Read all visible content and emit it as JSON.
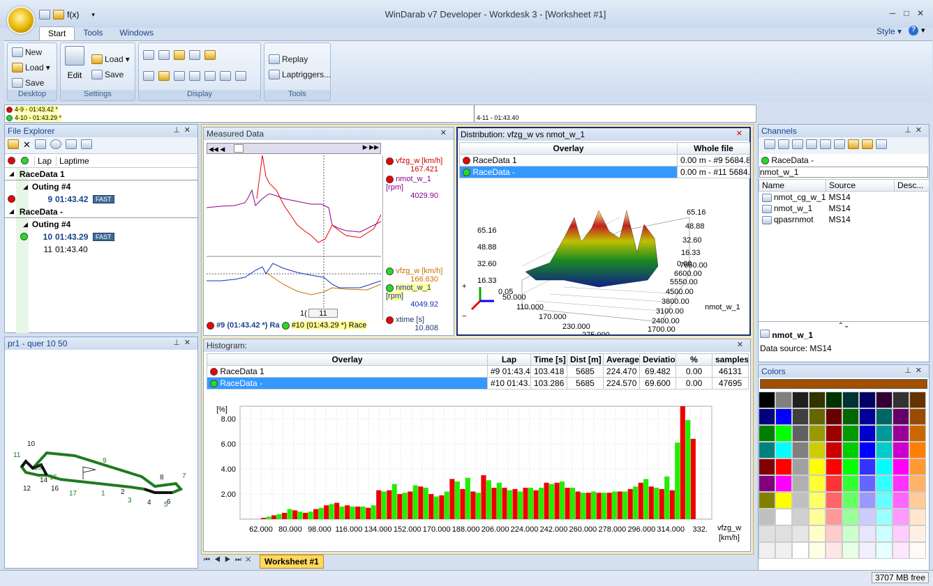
{
  "window": {
    "title": "WinDarab v7 Developer - Workdesk 3 - [Worksheet #1]",
    "qat_fx": "f(x)",
    "style_label": "Style"
  },
  "tabs": [
    {
      "label": "Start"
    },
    {
      "label": "Tools"
    },
    {
      "label": "Windows"
    }
  ],
  "ribbon": {
    "desktop": {
      "label": "Desktop",
      "new": "New",
      "load": "Load",
      "save": "Save"
    },
    "settings": {
      "label": "Settings",
      "edit": "Edit",
      "load": "Load",
      "save": "Save"
    },
    "display": {
      "label": "Display"
    },
    "tools": {
      "label": "Tools",
      "replay": "Replay",
      "laptriggers": "Laptriggers..."
    }
  },
  "lapbar": {
    "lap1": "4-9 - 01:43.42 *",
    "lap2": "4-10 - 01:43.29 *",
    "lap3": "4-11 - 01:43.40"
  },
  "file_explorer": {
    "title": "File Explorer",
    "col_lap": "Lap",
    "col_laptime": "Laptime",
    "rows": [
      {
        "kind": "file",
        "text": "RaceData 1"
      },
      {
        "kind": "outing",
        "text": "Outing #4"
      },
      {
        "kind": "lap",
        "lap": "9",
        "time": "01:43.42",
        "badge": "FAST",
        "dot": "red",
        "bold": true
      },
      {
        "kind": "file",
        "text": "RaceData -"
      },
      {
        "kind": "outing",
        "text": "Outing #4"
      },
      {
        "kind": "lap",
        "lap": "10",
        "time": "01:43.29",
        "badge": "FAST",
        "dot": "grn",
        "bold": true
      },
      {
        "kind": "lap",
        "lap": "11",
        "time": "01:43.40",
        "badge": "",
        "dot": "",
        "bold": false
      }
    ]
  },
  "track": {
    "title": "pr1 - quer 10 50",
    "labels": [
      "10",
      "11",
      "9",
      "13",
      "14",
      "15",
      "16",
      "12",
      "17",
      "1",
      "2",
      "3",
      "4",
      "5",
      "6",
      "7",
      "8"
    ]
  },
  "measured": {
    "title": "Measured Data",
    "ch1": {
      "name": "vfzg_w [km/h]",
      "value": "167.421"
    },
    "ch2": {
      "name": "nmot_w_1 [rpm]",
      "value": "4029.90"
    },
    "ch3": {
      "name": "vfzg_w [km/h]",
      "value": "166.630"
    },
    "ch4": {
      "name": "nmot_w_1 [rpm]",
      "value": "4049.92"
    },
    "ch5": {
      "name": "xtime [s]",
      "value": "10.808"
    },
    "cursor": "11",
    "cursor_left": "1(",
    "legend1": "#9 (01:43.42 *) Ra",
    "legend2": "#10 (01:43.29 *) Race"
  },
  "distribution": {
    "title": "Distribution: vfzg_w vs nmot_w_1",
    "col_overlay": "Overlay",
    "col_whole": "Whole file",
    "rows": [
      {
        "name": "RaceData 1",
        "range": "0.00 m - #9 5684.84"
      },
      {
        "name": "RaceData -",
        "range": "0.00 m - #11 5684.7"
      }
    ],
    "zlabels_left": [
      "65.16",
      "48.88",
      "32.60",
      "16.33",
      "0.05"
    ],
    "zlabels_right": [
      "65.16",
      "48.88",
      "32.60",
      "16.33",
      "0.00"
    ],
    "ylabels": [
      "7650.00",
      "6600.00",
      "5550.00",
      "4500.00",
      "3800.00",
      "3100.00",
      "2400.00",
      "1700.00"
    ],
    "xlabels": [
      "50.000",
      "110.000",
      "170.000",
      "230.000",
      "275.000"
    ],
    "axis_label": "nmot_w_1"
  },
  "histogram": {
    "title": "Histogram:",
    "cols": [
      "Overlay",
      "Lap",
      "Time [s]",
      "Dist [m]",
      "Average",
      "Deviation",
      "%",
      "samples"
    ],
    "rows": [
      {
        "name": "RaceData 1",
        "lap": "#9 01:43.42",
        "time": "103.418",
        "dist": "5685",
        "avg": "224.470",
        "dev": "69.482",
        "pct": "0.00",
        "samples": "46131"
      },
      {
        "name": "RaceData -",
        "lap": "#10 01:43.2",
        "time": "103.286",
        "dist": "5685",
        "avg": "224.570",
        "dev": "69.600",
        "pct": "0.00",
        "samples": "47695"
      }
    ],
    "ylabel": "[%]",
    "xlabel1": "vfzg_w",
    "xlabel2": "[km/h]"
  },
  "chart_data": {
    "type": "bar",
    "xticks": [
      "62.000",
      "80.000",
      "98.000",
      "116.000",
      "134.000",
      "152.000",
      "170.000",
      "188.000",
      "206.000",
      "224.000",
      "242.000",
      "260.000",
      "278.000",
      "296.000",
      "314.000",
      "332."
    ],
    "yticks": [
      "2.00",
      "4.00",
      "6.00",
      "8.00"
    ],
    "ylim": [
      0,
      9
    ],
    "series": [
      {
        "color": "#ee0000",
        "values": [
          0.1,
          0.3,
          0.5,
          0.7,
          0.5,
          0.8,
          1.1,
          1.3,
          1.1,
          1.0,
          0.9,
          2.3,
          2.3,
          2.0,
          2.2,
          2.6,
          2.0,
          1.9,
          3.2,
          2.4,
          2.2,
          3.5,
          2.5,
          2.5,
          2.4,
          2.5,
          2.3,
          2.9,
          2.9,
          2.5,
          2.2,
          2.1,
          2.1,
          2.1,
          2.2,
          2.4,
          2.9,
          2.6,
          2.4,
          2.3,
          9.0,
          6.4
        ]
      },
      {
        "color": "#22ee00",
        "values": [
          0.2,
          0.4,
          0.8,
          0.6,
          0.6,
          0.9,
          1.2,
          1.0,
          1.0,
          1.0,
          1.1,
          2.2,
          2.8,
          2.1,
          2.7,
          2.5,
          1.8,
          2.2,
          3.0,
          3.3,
          2.1,
          3.1,
          2.9,
          2.3,
          2.2,
          2.5,
          2.5,
          2.8,
          3.0,
          2.5,
          2.1,
          2.2,
          2.1,
          2.2,
          2.2,
          2.6,
          3.2,
          2.5,
          3.4,
          6.1,
          7.9,
          0.0
        ]
      }
    ]
  },
  "channels": {
    "title": "Channels",
    "source": "RaceData -",
    "filter": "nmot_w_1",
    "cols": [
      "Name",
      "Source",
      "Desc..."
    ],
    "rows": [
      {
        "name": "nmot_cg_w_1",
        "src": "MS14"
      },
      {
        "name": "nmot_w_1",
        "src": "MS14"
      },
      {
        "name": "qpasrnmot",
        "src": "MS14"
      }
    ],
    "detail_name": "nmot_w_1",
    "detail_source": "Data source: MS14"
  },
  "colors": {
    "title": "Colors",
    "current": "#a05000",
    "palette": [
      [
        "#000000",
        "#808080",
        "#202020",
        "#333300",
        "#003300",
        "#003333",
        "#000066",
        "#330033",
        "#333333"
      ],
      [
        "#000080",
        "#0000ff",
        "#404040",
        "#666600",
        "#660000",
        "#006600",
        "#000099",
        "#006666",
        "#660066"
      ],
      [
        "#008000",
        "#00ff00",
        "#606060",
        "#999900",
        "#990000",
        "#009900",
        "#0000cc",
        "#009999",
        "#990099"
      ],
      [
        "#008080",
        "#00ffff",
        "#808080",
        "#cccc00",
        "#cc0000",
        "#00cc00",
        "#0000ff",
        "#00cccc",
        "#cc00cc"
      ],
      [
        "#800000",
        "#ff0000",
        "#a0a0a0",
        "#ffff00",
        "#ff0000",
        "#00ff00",
        "#3333ff",
        "#00ffff",
        "#ff00ff"
      ],
      [
        "#800080",
        "#ff00ff",
        "#b0b0b0",
        "#ffff33",
        "#ff3333",
        "#33ff33",
        "#6666ff",
        "#33ffff",
        "#ff33ff"
      ],
      [
        "#808000",
        "#ffff00",
        "#c0c0c0",
        "#ffff66",
        "#ff6666",
        "#66ff66",
        "#9999ff",
        "#66ffff",
        "#ff66ff"
      ],
      [
        "#c0c0c0",
        "#ffffff",
        "#d0d0d0",
        "#ffff99",
        "#ff9999",
        "#99ff99",
        "#ccccff",
        "#99ffff",
        "#ff99ff"
      ],
      [
        "#e0e0e0",
        "#e0e0e0",
        "#e6e6e6",
        "#ffffcc",
        "#ffcccc",
        "#ccffcc",
        "#e6e6ff",
        "#ccffff",
        "#ffccff"
      ],
      [
        "#f0f0f0",
        "#f0f0f0",
        "#ffffff",
        "#ffffe6",
        "#ffe6e6",
        "#e6ffe6",
        "#f0f0ff",
        "#e6ffff",
        "#ffe6ff"
      ]
    ],
    "right_col": [
      "#663300",
      "#994c00",
      "#cc6600",
      "#ff8000",
      "#ff9933",
      "#ffb366",
      "#ffcc99",
      "#ffe6cc",
      "#fff0e6",
      "#fffaf5"
    ]
  },
  "bottom": {
    "worksheet_tab": "Worksheet #1"
  },
  "status": {
    "memory": "3707 MB free"
  }
}
